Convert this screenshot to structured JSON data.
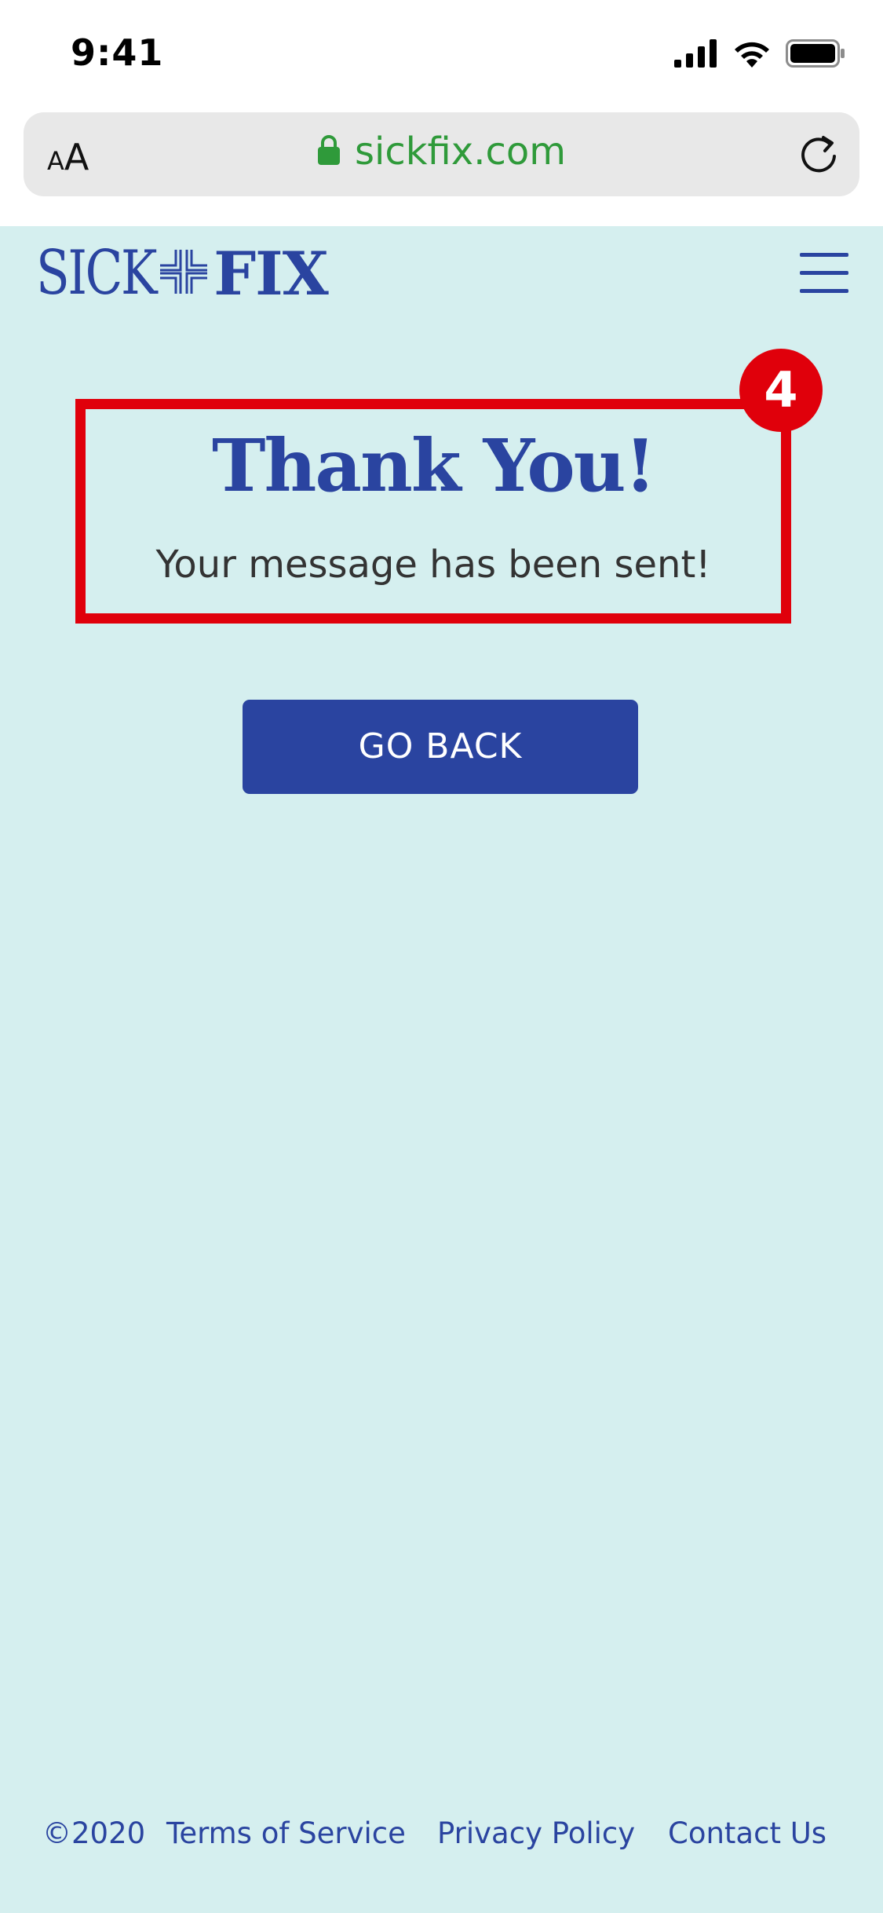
{
  "status_bar": {
    "time": "9:41"
  },
  "browser": {
    "text_size_label_small": "A",
    "text_size_label_big": "A",
    "url": "sickfix.com",
    "url_color": "#2f9a3a"
  },
  "header": {
    "logo_part1": "SICK",
    "logo_part2": "FIX",
    "menu_icon": "hamburger-icon"
  },
  "main": {
    "title": "Thank You!",
    "message": "Your message has been sent!",
    "go_back_label": "GO BACK",
    "annotation_number": "4"
  },
  "footer": {
    "copyright": "©2020",
    "terms": "Terms of Service",
    "privacy": "Privacy Policy",
    "contact": "Contact Us"
  },
  "colors": {
    "brand": "#2a44a0",
    "background": "#d5efef",
    "annotation": "#e0000b"
  }
}
